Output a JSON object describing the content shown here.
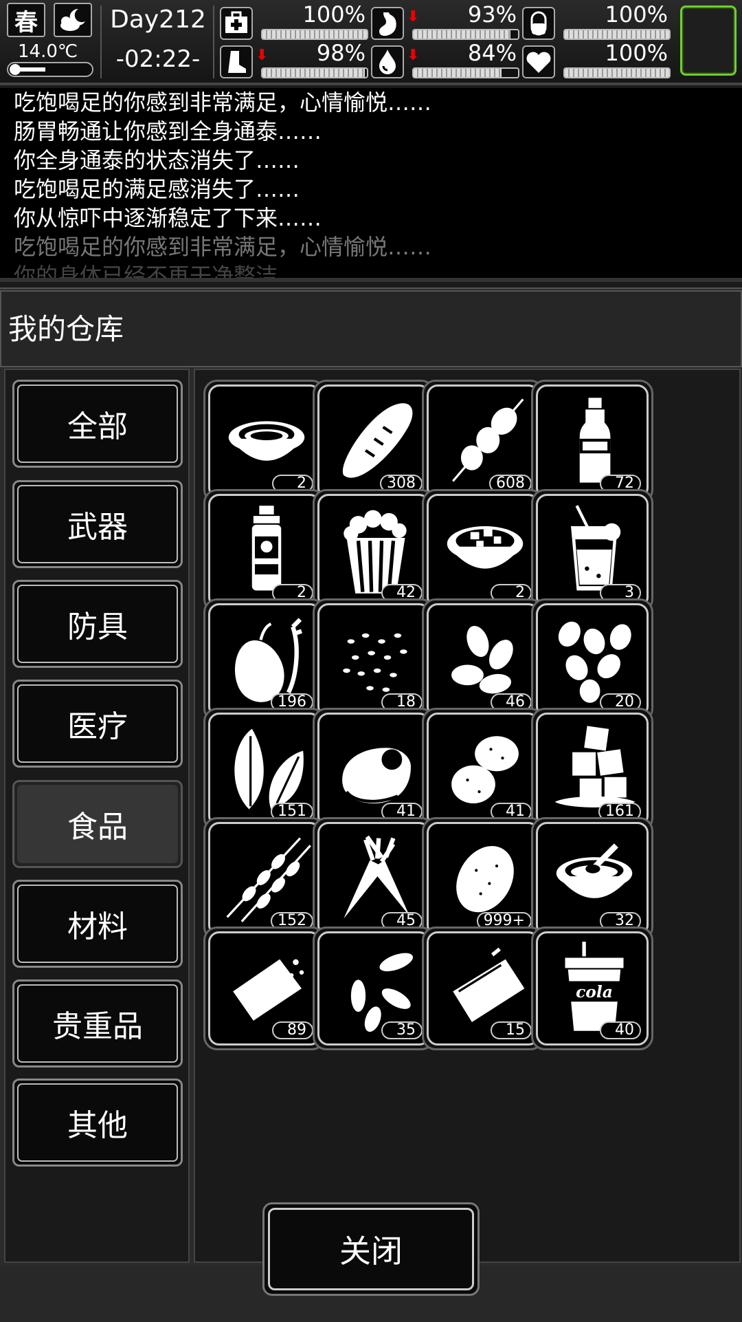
{
  "status": {
    "season": "春",
    "weather_icon": "night-cloud-icon",
    "temperature": "14.0℃",
    "temperature_level": 0.4,
    "day": "Day212",
    "time": "-02:22-",
    "stats": [
      {
        "name": "health",
        "icon": "medkit-icon",
        "value": "100%",
        "level": 1.0,
        "down": false
      },
      {
        "name": "hunger",
        "icon": "stomach-icon",
        "value": "93%",
        "level": 0.93,
        "down": true
      },
      {
        "name": "armor",
        "icon": "capsule-icon",
        "value": "100%",
        "level": 1.0,
        "down": false
      },
      {
        "name": "stamina",
        "icon": "boot-icon",
        "value": "98%",
        "level": 0.98,
        "down": true
      },
      {
        "name": "thirst",
        "icon": "water-drop-icon",
        "value": "84%",
        "level": 0.84,
        "down": true
      },
      {
        "name": "mood",
        "icon": "heart-icon",
        "value": "100%",
        "level": 1.0,
        "down": false
      }
    ],
    "slot_border_color": "#6fcf2f"
  },
  "log": [
    "吃饱喝足的你感到非常满足，心情愉悦……",
    "肠胃畅通让你感到全身通泰……",
    "你全身通泰的状态消失了……",
    "吃饱喝足的满足感消失了……",
    "你从惊吓中逐渐稳定了下来……",
    "吃饱喝足的你感到非常满足，心情愉悦……",
    "你的身体已经不再干净整洁……"
  ],
  "warehouse": {
    "title": "我的仓库",
    "categories": [
      "全部",
      "武器",
      "防具",
      "医疗",
      "食品",
      "材料",
      "贵重品",
      "其他"
    ],
    "selected_category": "食品",
    "items": [
      {
        "icon": "soup-bowl-icon",
        "count": "2"
      },
      {
        "icon": "bread-icon",
        "count": "308"
      },
      {
        "icon": "skewer-icon",
        "count": "608"
      },
      {
        "icon": "water-bottle-icon",
        "count": "72"
      },
      {
        "icon": "drink-bottle-icon",
        "count": "2"
      },
      {
        "icon": "popcorn-icon",
        "count": "42"
      },
      {
        "icon": "stew-bowl-icon",
        "count": "2"
      },
      {
        "icon": "juice-glass-icon",
        "count": "3"
      },
      {
        "icon": "root-vegetable-icon",
        "count": "196"
      },
      {
        "icon": "seeds-icon",
        "count": "18"
      },
      {
        "icon": "almonds-icon",
        "count": "46"
      },
      {
        "icon": "nuts-icon",
        "count": "20"
      },
      {
        "icon": "leaves-icon",
        "count": "151"
      },
      {
        "icon": "raw-meat-icon",
        "count": "41"
      },
      {
        "icon": "potatoes-icon",
        "count": "41"
      },
      {
        "icon": "ice-cubes-icon",
        "count": "161"
      },
      {
        "icon": "meat-skewers-icon",
        "count": "152"
      },
      {
        "icon": "carrots-icon",
        "count": "45"
      },
      {
        "icon": "potato-icon",
        "count": "999+"
      },
      {
        "icon": "noodle-bowl-icon",
        "count": "32"
      },
      {
        "icon": "cracker-icon",
        "count": "89"
      },
      {
        "icon": "sunflower-seeds-icon",
        "count": "35"
      },
      {
        "icon": "canned-fish-icon",
        "count": "15"
      },
      {
        "icon": "cola-cup-icon",
        "count": "40"
      }
    ],
    "cola_text": "cola",
    "close_label": "关闭"
  }
}
